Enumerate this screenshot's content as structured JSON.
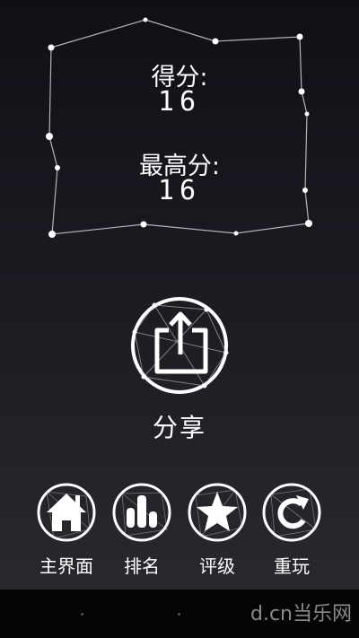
{
  "score_panel": {
    "score_label": "得分:",
    "score_value": "16",
    "best_label": "最高分:",
    "best_value": "16"
  },
  "share": {
    "label": "分享",
    "icon": "share-icon"
  },
  "menu": [
    {
      "id": "home",
      "label": "主界面",
      "icon": "home-icon"
    },
    {
      "id": "rank",
      "label": "排名",
      "icon": "bar-chart-icon"
    },
    {
      "id": "rate",
      "label": "评级",
      "icon": "star-icon"
    },
    {
      "id": "replay",
      "label": "重玩",
      "icon": "replay-icon"
    }
  ],
  "watermark": "d.cn当乐网",
  "colors": {
    "line": "#d8d8dc",
    "text": "#ffffff",
    "bg_top": "#0f1016",
    "bg_bottom": "#2a2a2f"
  }
}
